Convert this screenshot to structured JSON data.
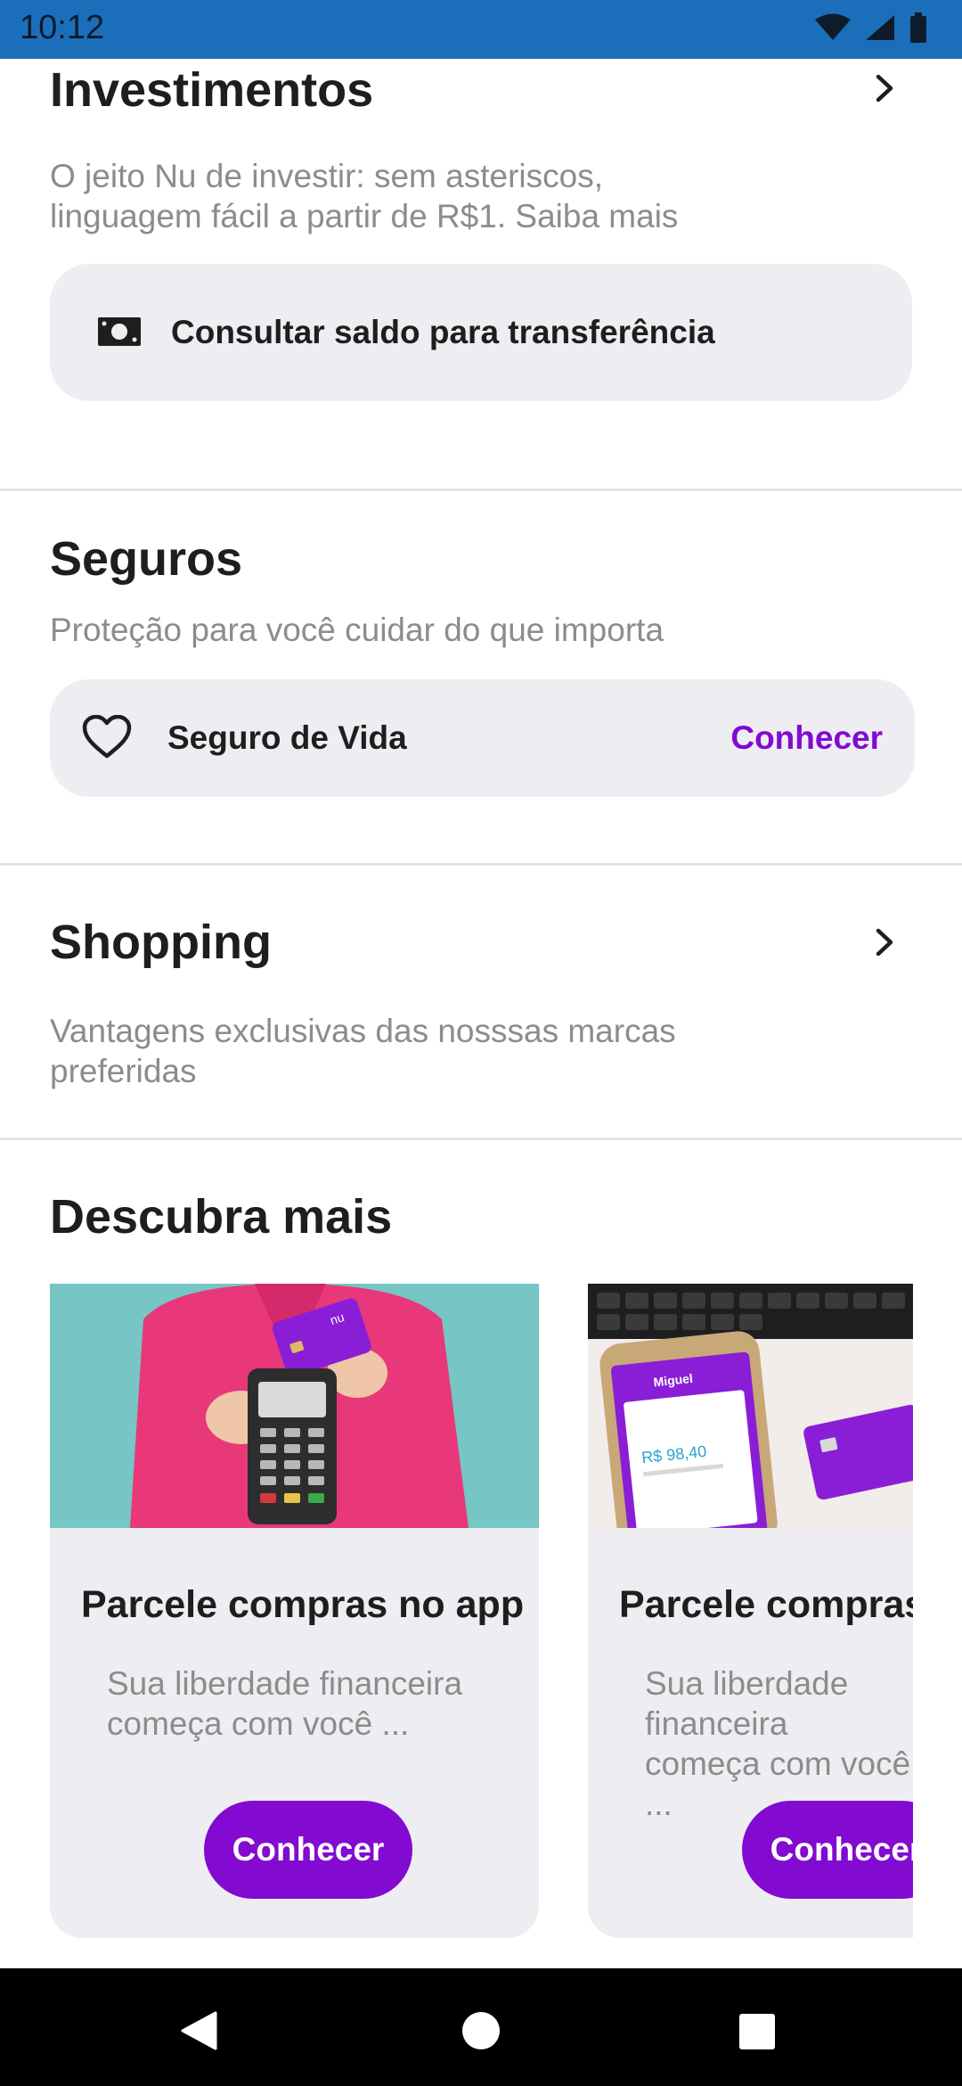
{
  "status_bar": {
    "time": "10:12"
  },
  "investimentos": {
    "title": "Investimentos",
    "description": "O jeito Nu de investir: sem asteriscos,\nlinguagem fácil a partir de R$1. Saiba mais",
    "action_label": "Consultar saldo para transferência",
    "action_icon": "money-bill-icon"
  },
  "seguros": {
    "title": "Seguros",
    "description": "Proteção para você cuidar do que importa",
    "item_label": "Seguro de Vida",
    "item_icon": "heart-icon",
    "item_action": "Conhecer"
  },
  "shopping": {
    "title": "Shopping",
    "description": "Vantagens exclusivas das nosssas marcas\n preferidas"
  },
  "descubra": {
    "title": "Descubra mais",
    "cards": [
      {
        "title": "Parcele compras no app",
        "description": "Sua liberdade financeira\ncomeça com você ...",
        "button": "Conhecer",
        "image_card_label": "nu"
      },
      {
        "title": "Parcele compras no app",
        "description": "Sua liberdade financeira\ncomeça com você ...",
        "button": "Conhecer",
        "phone_name": "Miguel",
        "phone_amount": "R$ 98,40"
      }
    ]
  },
  "colors": {
    "accent": "#820ad1",
    "status_bar": "#1b6fba",
    "pill_background": "#eeeef2"
  }
}
